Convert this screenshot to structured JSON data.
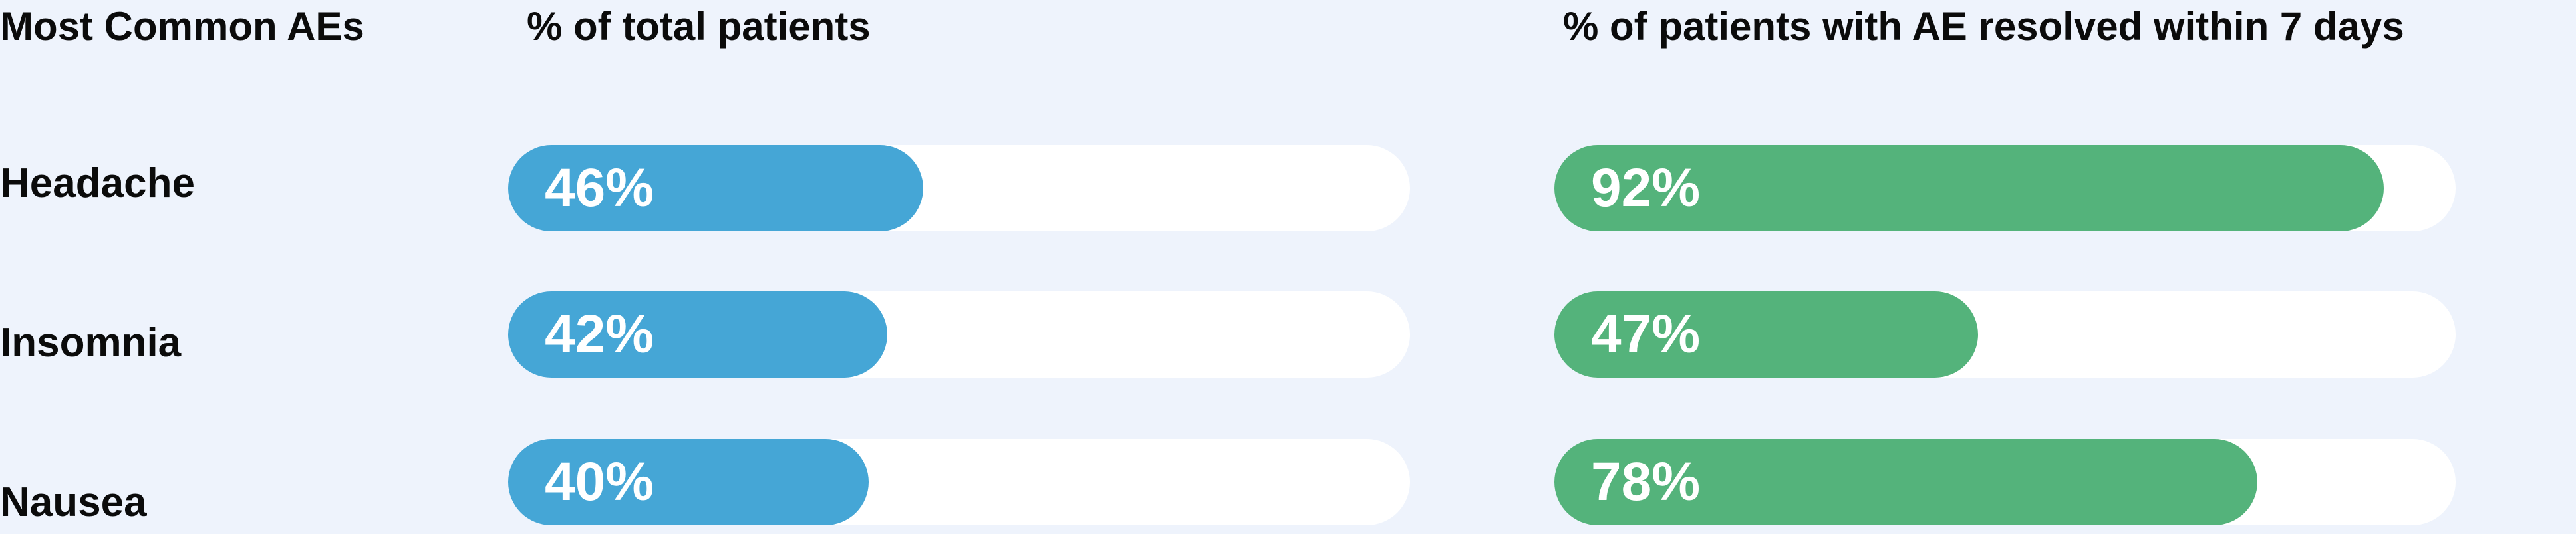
{
  "chart_data": {
    "type": "bar",
    "orientation": "horizontal",
    "xlim": [
      0,
      100
    ],
    "header": {
      "category_label": "Most Common AEs",
      "series_0_label": "% of total patients",
      "series_1_label": "% of patients with AE resolved within 7 days"
    },
    "categories": [
      "Headache",
      "Insomnia",
      "Nausea"
    ],
    "series": [
      {
        "name": "% of total patients",
        "color": "#45a6d6",
        "values": [
          46,
          42,
          40
        ],
        "labels": [
          "46%",
          "42%",
          "40%"
        ]
      },
      {
        "name": "% of patients with AE resolved within 7 days",
        "color": "#54b37b",
        "values": [
          92,
          47,
          78
        ],
        "labels": [
          "92%",
          "47%",
          "78%"
        ]
      }
    ]
  }
}
